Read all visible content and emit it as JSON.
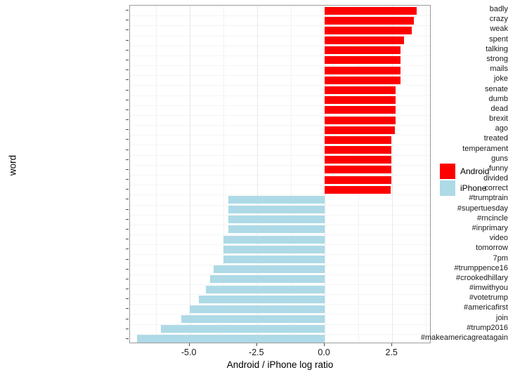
{
  "chart_data": {
    "type": "bar",
    "title": "",
    "subtitle": "",
    "orientation": "horizontal",
    "xlabel": "Android / iPhone log ratio",
    "ylabel": "word",
    "xlim": [
      -7.2,
      3.95
    ],
    "xticks": [
      -5.0,
      -2.5,
      0.0,
      2.5
    ],
    "xtick_labels": [
      "-5.0",
      "-2.5",
      "0.0",
      "2.5"
    ],
    "grid": true,
    "legend_position": "right",
    "legend": [
      {
        "name": "Android",
        "color": "#ff0000"
      },
      {
        "name": "iPhone",
        "color": "#addae6"
      }
    ],
    "categories": [
      "badly",
      "crazy",
      "weak",
      "spent",
      "talking",
      "strong",
      "mails",
      "joke",
      "senate",
      "dumb",
      "dead",
      "brexit",
      "ago",
      "treated",
      "temperament",
      "guns",
      "funny",
      "divided",
      "correct",
      "#trumptrain",
      "#supertuesday",
      "#rncincle",
      "#inprimary",
      "video",
      "tomorrow",
      "7pm",
      "#trumppence16",
      "#crookedhillary",
      "#imwithyou",
      "#votetrump",
      "#americafirst",
      "join",
      "#trump2016",
      "#makeamericagreatagain"
    ],
    "values": [
      3.4,
      3.29,
      3.21,
      2.93,
      2.8,
      2.8,
      2.8,
      2.8,
      2.62,
      2.62,
      2.62,
      2.62,
      2.6,
      2.46,
      2.46,
      2.46,
      2.46,
      2.46,
      2.45,
      -3.55,
      -3.55,
      -3.55,
      -3.55,
      -3.75,
      -3.75,
      -3.75,
      -4.1,
      -4.25,
      -4.4,
      -4.65,
      -5.0,
      -5.3,
      -6.05,
      -6.95
    ],
    "groups": [
      "Android",
      "Android",
      "Android",
      "Android",
      "Android",
      "Android",
      "Android",
      "Android",
      "Android",
      "Android",
      "Android",
      "Android",
      "Android",
      "Android",
      "Android",
      "Android",
      "Android",
      "Android",
      "Android",
      "iPhone",
      "iPhone",
      "iPhone",
      "iPhone",
      "iPhone",
      "iPhone",
      "iPhone",
      "iPhone",
      "iPhone",
      "iPhone",
      "iPhone",
      "iPhone",
      "iPhone",
      "iPhone",
      "iPhone"
    ]
  }
}
